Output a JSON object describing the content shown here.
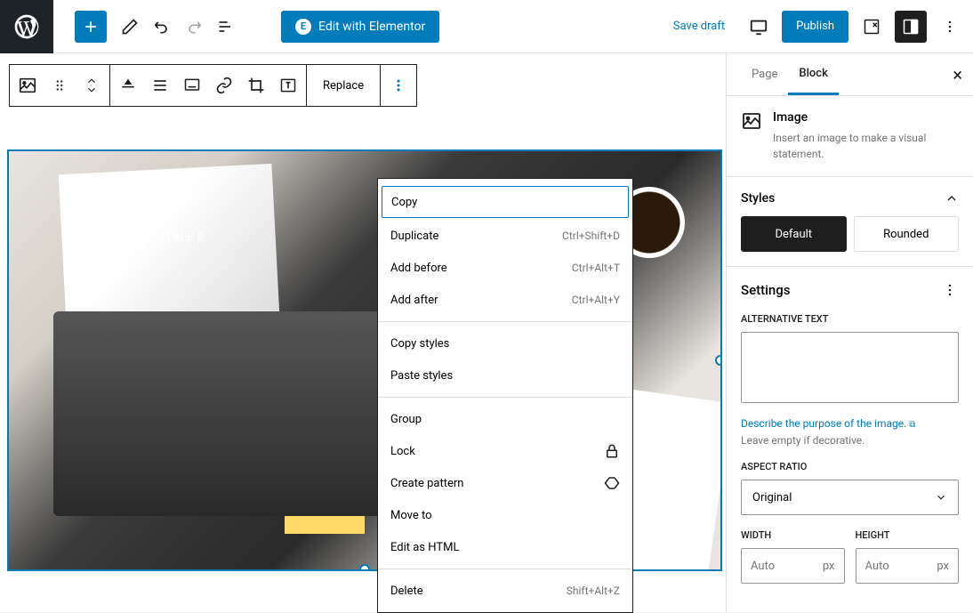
{
  "topbar": {
    "elementor_label": "Edit with Elementor",
    "save_draft": "Save draft",
    "publish": "Publish"
  },
  "block_toolbar": {
    "replace": "Replace"
  },
  "canvas": {
    "image_overlay_text": "SUMMER"
  },
  "context_menu": {
    "sections": [
      [
        {
          "label": "Copy",
          "shortcut": "",
          "highlighted": true
        },
        {
          "label": "Duplicate",
          "shortcut": "Ctrl+Shift+D"
        },
        {
          "label": "Add before",
          "shortcut": "Ctrl+Alt+T"
        },
        {
          "label": "Add after",
          "shortcut": "Ctrl+Alt+Y"
        }
      ],
      [
        {
          "label": "Copy styles",
          "shortcut": ""
        },
        {
          "label": "Paste styles",
          "shortcut": ""
        }
      ],
      [
        {
          "label": "Group",
          "shortcut": ""
        },
        {
          "label": "Lock",
          "shortcut": "",
          "icon": "lock"
        },
        {
          "label": "Create pattern",
          "shortcut": "",
          "icon": "diamond"
        },
        {
          "label": "Move to",
          "shortcut": ""
        },
        {
          "label": "Edit as HTML",
          "shortcut": ""
        }
      ],
      [
        {
          "label": "Delete",
          "shortcut": "Shift+Alt+Z"
        }
      ]
    ]
  },
  "sidebar": {
    "tabs": {
      "page": "Page",
      "block": "Block"
    },
    "block_info": {
      "title": "Image",
      "desc": "Insert an image to make a visual statement."
    },
    "styles": {
      "heading": "Styles",
      "options": [
        "Default",
        "Rounded"
      ],
      "active": 0
    },
    "settings": {
      "heading": "Settings",
      "alt_label": "ALTERNATIVE TEXT",
      "alt_value": "",
      "alt_link": "Describe the purpose of the image.",
      "alt_helper": "Leave empty if decorative.",
      "aspect_label": "ASPECT RATIO",
      "aspect_value": "Original",
      "width_label": "WIDTH",
      "height_label": "HEIGHT",
      "width_placeholder": "Auto",
      "height_placeholder": "Auto",
      "unit": "px"
    }
  }
}
